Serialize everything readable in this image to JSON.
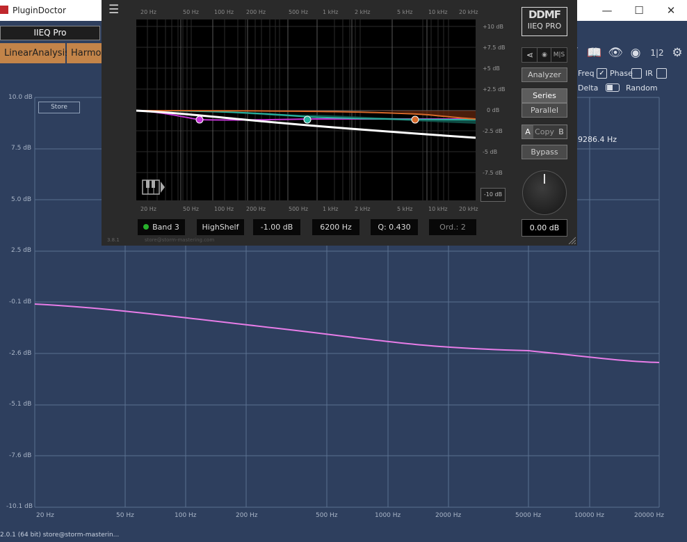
{
  "window": {
    "title": "PluginDoctor",
    "min_icon": "minimize-icon",
    "max_icon": "maximize-icon",
    "close_icon": "close-icon"
  },
  "host": {
    "preset": "IIEQ Pro",
    "tabs": [
      {
        "label": "LinearAnalysis"
      },
      {
        "label": "Harmo"
      }
    ],
    "toolbar_icons": [
      "book-icon",
      "eye-icon",
      "camera-icon",
      "split-view-icon",
      "gear-icon"
    ],
    "split_label": "1|2",
    "options": {
      "freq": {
        "label": "Freq"
      },
      "phase": {
        "label": "Phase",
        "checked": true
      },
      "ir": {
        "label": "IR",
        "checked": false
      },
      "delta": {
        "label": "Delta"
      },
      "random": {
        "label": "Random"
      }
    },
    "store_label": "Store",
    "cursor_readout": "9286.4 Hz",
    "y_axis": [
      "10.0 dB",
      "7.5 dB",
      "5.0 dB",
      "2.5 dB",
      "-0.1 dB",
      "-2.6 dB",
      "-5.1 dB",
      "-7.6 dB",
      "-10.1 dB"
    ],
    "x_axis": [
      "20 Hz",
      "50 Hz",
      "100 Hz",
      "200 Hz",
      "500 Hz",
      "1000 Hz",
      "2000 Hz",
      "5000 Hz",
      "10000 Hz",
      "20000 Hz"
    ],
    "status": "2.0.1 (64 bit)   store@storm-masterin...",
    "curve_color": "#e87de8"
  },
  "plugin": {
    "logo_line1": "DDMF",
    "logo_line2": "IIEQ PRO",
    "freq_labels": [
      "20 Hz",
      "50 Hz",
      "100 Hz",
      "200 Hz",
      "500 Hz",
      "1 kHz",
      "2 kHz",
      "5 kHz",
      "10 kHz",
      "20 kHz"
    ],
    "db_labels": [
      "+10 dB",
      "+7.5 dB",
      "+5 dB",
      "+2.5 dB",
      "0 dB",
      "-2.5 dB",
      "-5 dB",
      "-7.5 dB"
    ],
    "db_range": "-10 dB",
    "routing_icons": {
      "route": "routing-icon",
      "lock": "lock-icon"
    },
    "ms_label": "M|S",
    "analyzer_label": "Analyzer",
    "series_label": "Series",
    "parallel_label": "Parallel",
    "ab": {
      "a": "A",
      "copy": "Copy",
      "b": "B"
    },
    "bypass_label": "Bypass",
    "output_gain": "0.00 dB",
    "band": {
      "name": "Band 3",
      "type": "HighShelf",
      "gain": "-1.00 dB",
      "freq": "6200 Hz",
      "q": "Q: 0.430",
      "order": "Ord.: 2"
    },
    "version": "3.8.1",
    "website": "store@storm-mastering.com",
    "band_colors": {
      "band1": "#c535d6",
      "band2": "#2ab3a0",
      "band3": "#d86a2a",
      "sum": "#ffffff"
    }
  }
}
